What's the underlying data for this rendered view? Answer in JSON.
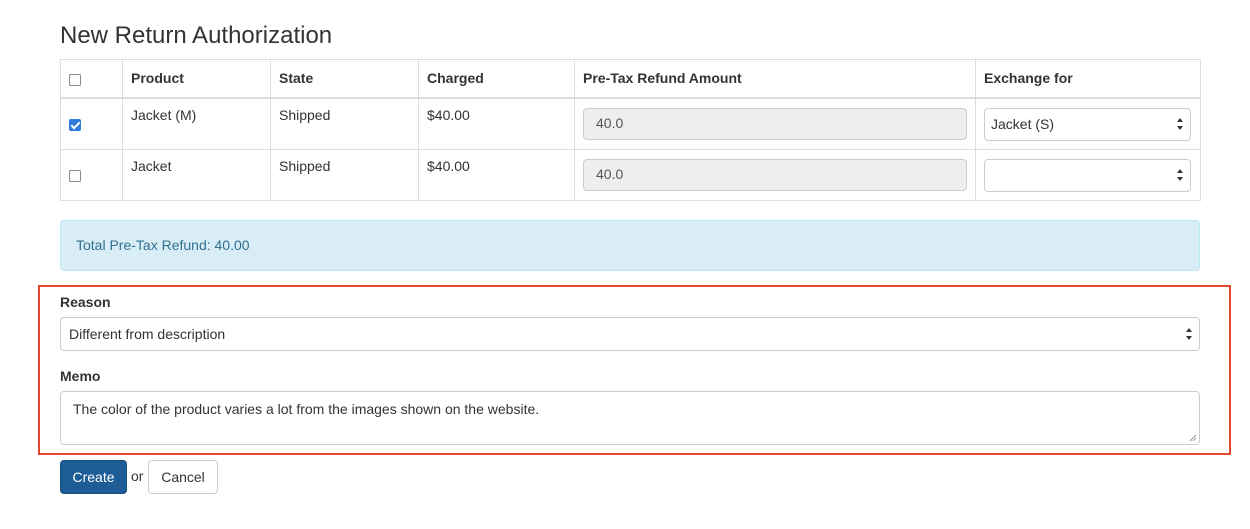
{
  "page": {
    "title": "New Return Authorization"
  },
  "table": {
    "headers": {
      "product": "Product",
      "state": "State",
      "charged": "Charged",
      "refund": "Pre-Tax Refund Amount",
      "exchange": "Exchange for"
    },
    "rows": [
      {
        "checked": true,
        "product": "Jacket (M)",
        "state": "Shipped",
        "charged": "$40.00",
        "refund": "40.0",
        "exchange": "Jacket (S)"
      },
      {
        "checked": false,
        "product": "Jacket",
        "state": "Shipped",
        "charged": "$40.00",
        "refund": "40.0",
        "exchange": ""
      }
    ]
  },
  "summary": {
    "total_text": "Total Pre-Tax Refund: 40.00"
  },
  "form": {
    "reason_label": "Reason",
    "reason_value": "Different from description",
    "memo_label": "Memo",
    "memo_value": "The color of the product varies a lot from the images shown on the website."
  },
  "actions": {
    "create_label": "Create",
    "or_text": "or",
    "cancel_label": "Cancel"
  },
  "colors": {
    "primary_button": "#1e5c96",
    "info_background": "#d9edf7",
    "highlight_border": "#e0472b",
    "checkbox_checked": "#2f7bd9"
  },
  "icons": {
    "select_arrows": "up-down-arrows-icon",
    "checkbox_check": "check-icon",
    "resize_grip": "resize-grip-icon"
  }
}
